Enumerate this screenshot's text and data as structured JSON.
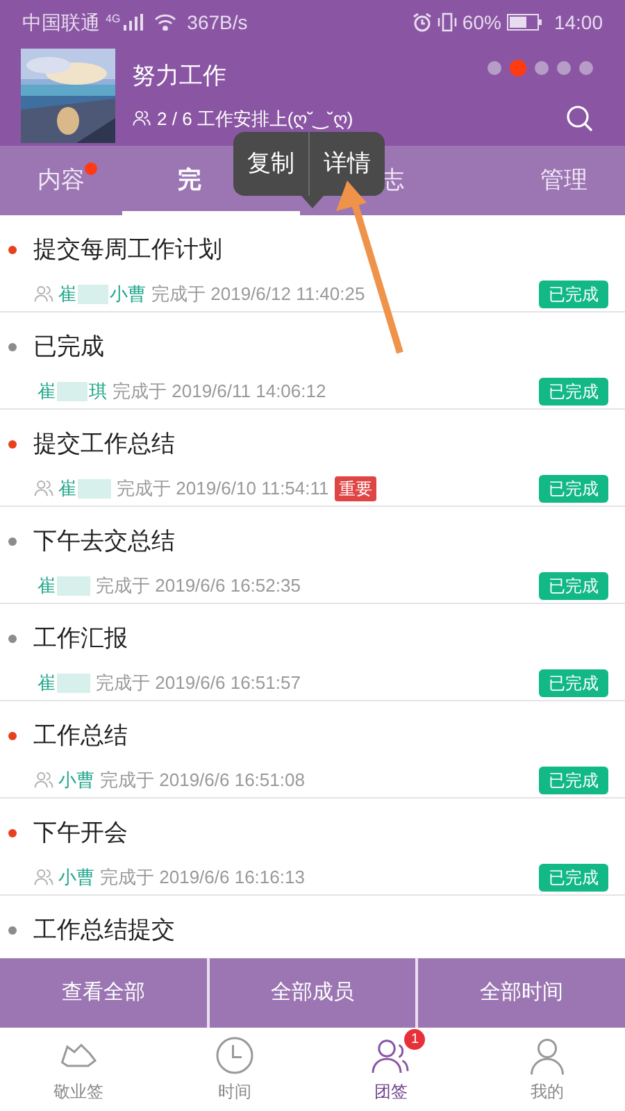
{
  "status_bar": {
    "carrier": "中国联通",
    "network": "4G",
    "speed": "367B/s",
    "battery": "60%",
    "time": "14:00"
  },
  "header": {
    "title": "努力工作",
    "subtitle": "2 / 6 工作安排上(ღ˘‿˘ღ)",
    "pages": [
      {
        "selected": false
      },
      {
        "selected": true
      },
      {
        "selected": false
      },
      {
        "selected": false
      },
      {
        "selected": false
      }
    ]
  },
  "tabs": [
    {
      "label": "内容",
      "selected": false,
      "unread": true
    },
    {
      "label": "完",
      "selected": true,
      "unread": false
    },
    {
      "label": "志",
      "selected": false,
      "unread": false
    },
    {
      "label": "管理",
      "selected": false,
      "unread": false
    }
  ],
  "popup_menu": [
    "复制",
    "详情"
  ],
  "items": [
    {
      "title": "提交每周工作计划",
      "color": "#e8401c",
      "group": true,
      "assignee": [
        "崔",
        "小曹"
      ],
      "done_label": "完成于",
      "time": "2019/6/12 11:40:25",
      "status": "已完成"
    },
    {
      "title": "已完成",
      "color": "#8c8c8c",
      "group": false,
      "assignee": [
        "崔",
        "琪"
      ],
      "done_label": "完成于",
      "time": "2019/6/11 14:06:12",
      "status": "已完成"
    },
    {
      "title": "提交工作总结",
      "color": "#e8401c",
      "group": true,
      "assignee": [
        "崔"
      ],
      "done_label": "完成于",
      "time": "2019/6/10 11:54:11",
      "tag": "重要",
      "status": "已完成"
    },
    {
      "title": "下午去交总结",
      "color": "#8c8c8c",
      "group": false,
      "assignee": [
        "崔"
      ],
      "done_label": "完成于",
      "time": "2019/6/6 16:52:35",
      "status": "已完成"
    },
    {
      "title": "工作汇报",
      "color": "#8c8c8c",
      "group": false,
      "assignee": [
        "崔"
      ],
      "done_label": "完成于",
      "time": "2019/6/6 16:51:57",
      "status": "已完成"
    },
    {
      "title": "工作总结",
      "color": "#e8401c",
      "group": true,
      "assignee": [
        "小曹"
      ],
      "done_label": "完成于",
      "time": "2019/6/6 16:51:08",
      "status": "已完成"
    },
    {
      "title": "下午开会",
      "color": "#e8401c",
      "group": true,
      "assignee": [
        "小曹"
      ],
      "done_label": "完成于",
      "time": "2019/6/6 16:16:13",
      "status": "已完成"
    },
    {
      "title": "工作总结提交",
      "color": "#8c8c8c"
    }
  ],
  "filters": [
    "查看全部",
    "全部成员",
    "全部时间"
  ],
  "nav": [
    {
      "label": "敬业签",
      "kind": "cloud",
      "selected": false
    },
    {
      "label": "时间",
      "kind": "clock",
      "selected": false
    },
    {
      "label": "团签",
      "kind": "people",
      "selected": true,
      "badge": "1"
    },
    {
      "label": "我的",
      "kind": "person",
      "selected": false
    }
  ]
}
